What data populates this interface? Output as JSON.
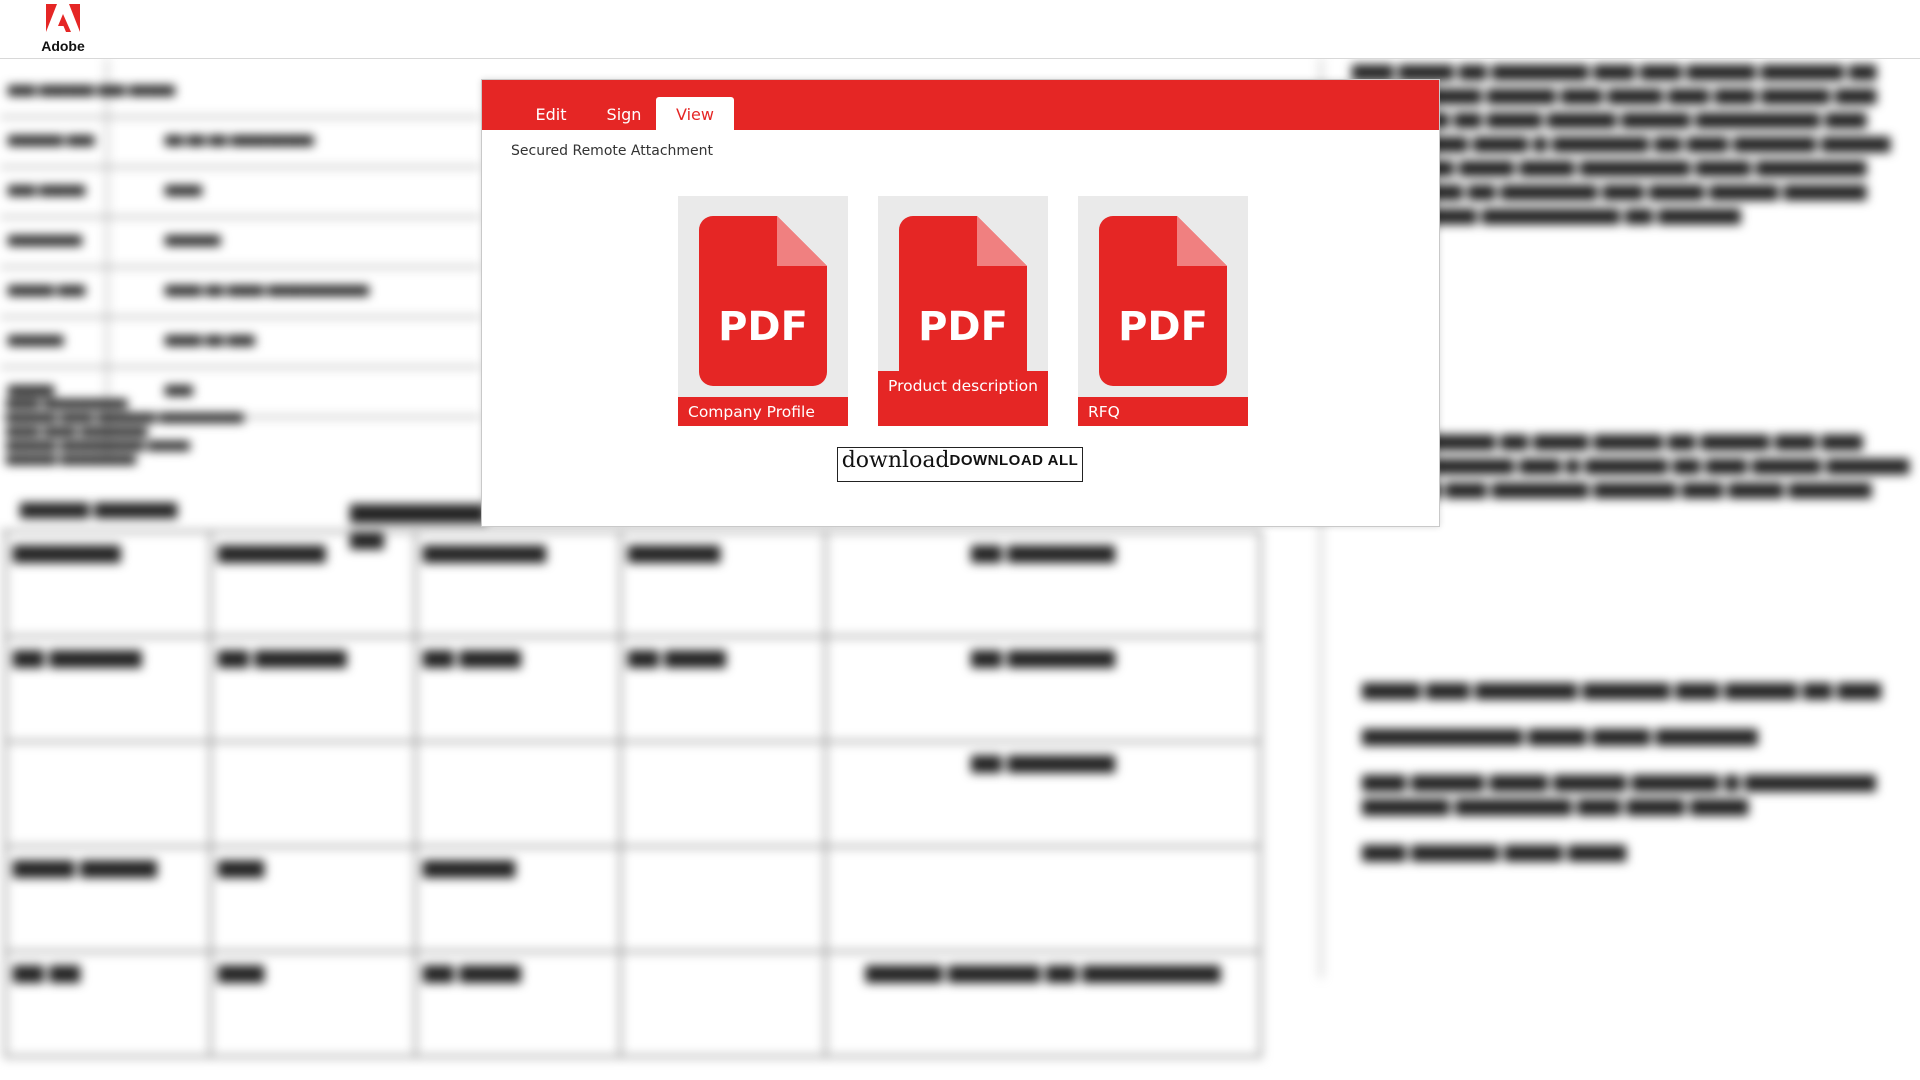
{
  "header": {
    "brand": "Adobe"
  },
  "colors": {
    "accent": "#e52625",
    "card_bg": "#eaeaea",
    "tab_active_bg": "#ffffff"
  },
  "modal": {
    "tabs": [
      {
        "label": "Edit",
        "active": false
      },
      {
        "label": "Sign",
        "active": false
      },
      {
        "label": "View",
        "active": true
      }
    ],
    "subtitle": "Secured Remote Attachment",
    "files": [
      {
        "icon": "pdf-icon",
        "icon_text": "PDF",
        "label": "Company Profile"
      },
      {
        "icon": "pdf-icon",
        "icon_text": "PDF",
        "label": "Product description"
      },
      {
        "icon": "pdf-icon",
        "icon_text": "PDF",
        "label": "RFQ"
      }
    ],
    "download_button": {
      "icon_text": "download",
      "label": "DOWNLOAD ALL"
    }
  }
}
